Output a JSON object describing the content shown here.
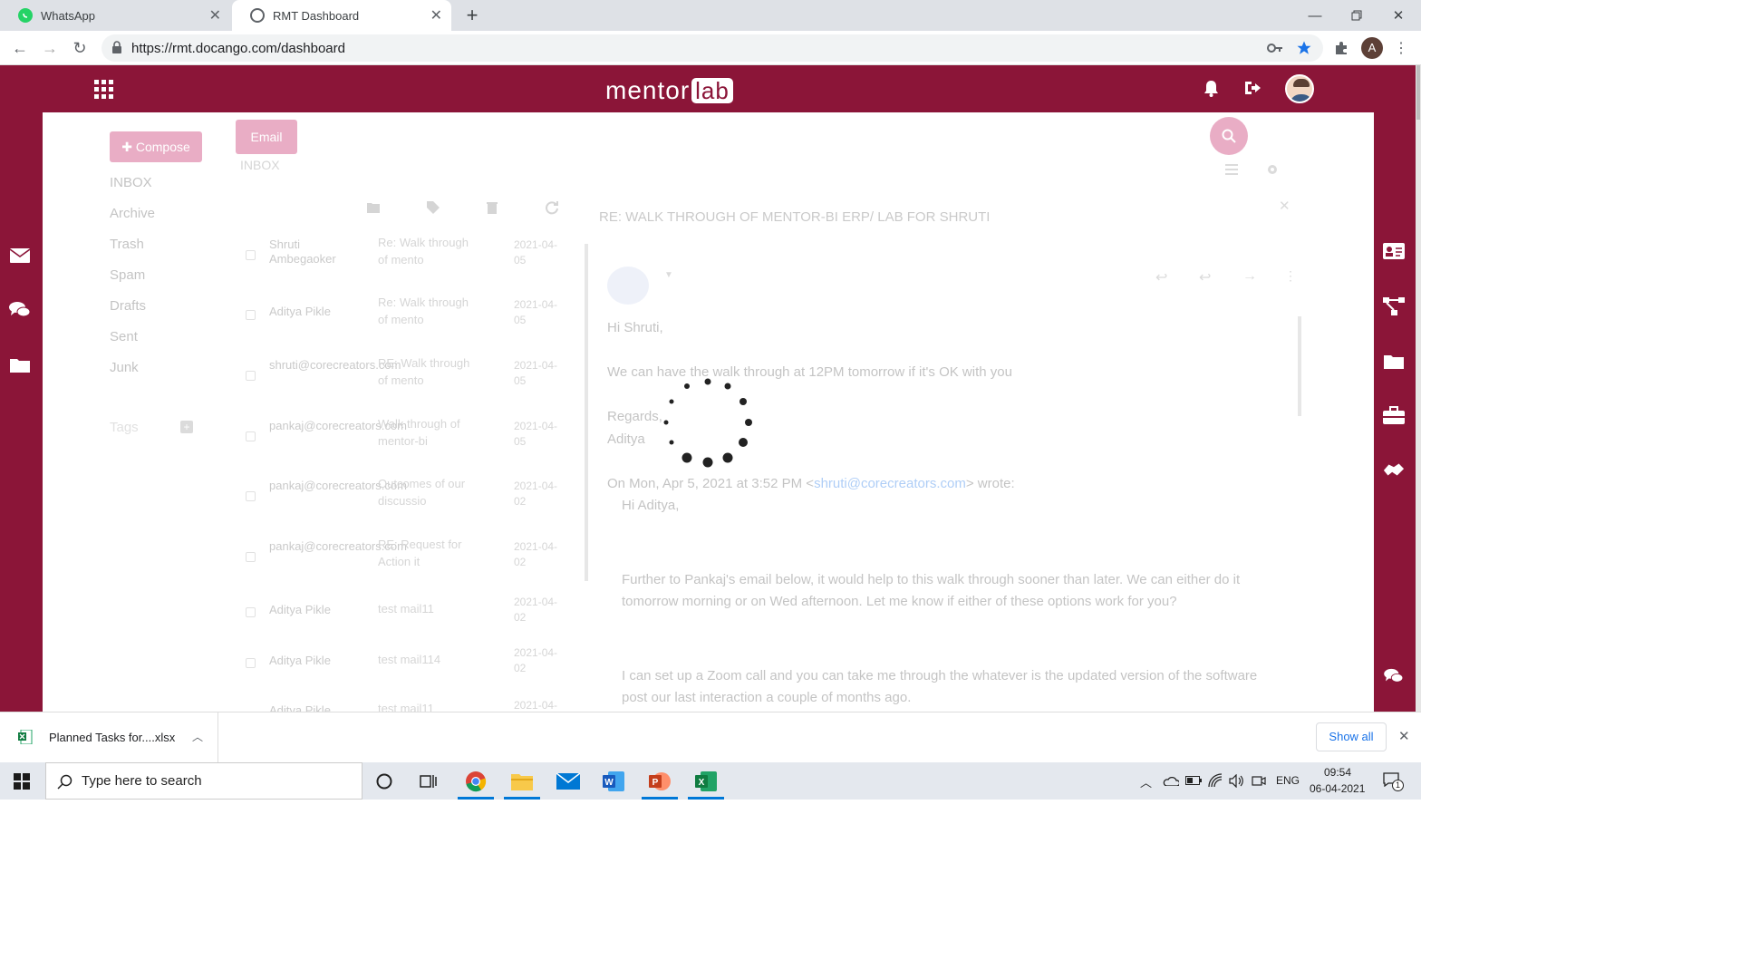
{
  "browser": {
    "tabs": [
      {
        "title": "WhatsApp",
        "favicon": "whatsapp-icon",
        "active": false
      },
      {
        "title": "RMT Dashboard",
        "favicon": "globe-icon",
        "active": true
      }
    ],
    "url": "https://rmt.docango.com/dashboard",
    "profile_initial": "A"
  },
  "app": {
    "logo_text": "mentor",
    "logo_badge": "lab",
    "brand_color": "#8b1538",
    "compose_label": "Compose",
    "email_tab_label": "Email",
    "inbox_heading": "INBOX",
    "folders": [
      "INBOX",
      "Archive",
      "Trash",
      "Spam",
      "Drafts",
      "Sent",
      "Junk"
    ],
    "tags_label": "Tags",
    "mails": [
      {
        "from": "Shruti Ambegaoker",
        "subject": "Re: Walk through of mento",
        "date": "2021-04-05"
      },
      {
        "from": "Aditya Pikle",
        "subject": "Re: Walk through of mento",
        "date": "2021-04-05"
      },
      {
        "from": "shruti@corecreators.com",
        "subject": "RE: Walk through of mento",
        "date": "2021-04-05"
      },
      {
        "from": "pankaj@corecreators.com",
        "subject": "Walk through of mentor-bi",
        "date": "2021-04-05"
      },
      {
        "from": "pankaj@corecreators.com",
        "subject": "Outcomes of our discussio",
        "date": "2021-04-02"
      },
      {
        "from": "pankaj@corecreators.com",
        "subject": "RE: Request for Action it",
        "date": "2021-04-02"
      },
      {
        "from": "Aditya Pikle",
        "subject": "test mail11",
        "date": "2021-04-02"
      },
      {
        "from": "Aditya Pikle",
        "subject": "test mail114",
        "date": "2021-04-02"
      },
      {
        "from": "Aditya Pikle",
        "subject": "test mail11",
        "date": "2021-04-"
      }
    ],
    "reading": {
      "subject": "RE: WALK THROUGH OF MENTOR-BI ERP/ LAB FOR SHRUTI",
      "greeting": "Hi Shruti,",
      "line1": "We can have the walk through at 12PM tomorrow if it's OK with you",
      "regards": "Regards,",
      "signature": "Aditya",
      "quote_header_pre": "On Mon, Apr 5, 2021 at 3:52 PM <",
      "quote_email": "shruti@corecreators.com",
      "quote_header_post": "> wrote:",
      "quote_greeting": "Hi Aditya,",
      "quote_para1": "Further to Pankaj's email below, it would help to this walk through sooner than later. We can either do it tomorrow morning or on Wed afternoon. Let me know if either of these options work for you?",
      "quote_para2": "I can set up a Zoom call and you can take me through the whatever is the updated version of the software post our last interaction a couple of months ago."
    }
  },
  "download": {
    "filename": "Planned Tasks for....xlsx",
    "show_all_label": "Show all"
  },
  "taskbar": {
    "search_placeholder": "Type here to search",
    "language": "ENG",
    "time": "09:54",
    "date": "06-04-2021",
    "notification_count": "1"
  }
}
